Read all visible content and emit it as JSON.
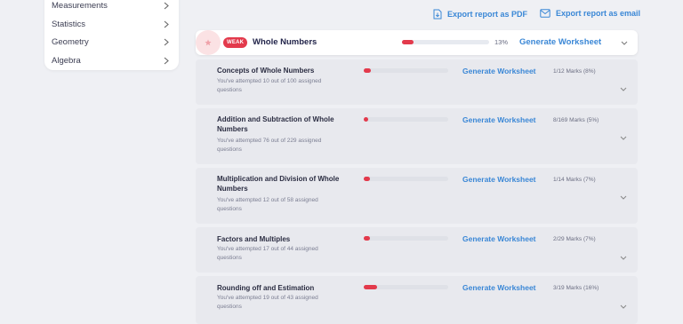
{
  "sidebar": {
    "items": [
      {
        "label": "Measurements"
      },
      {
        "label": "Statistics"
      },
      {
        "label": "Geometry"
      },
      {
        "label": "Algebra"
      }
    ]
  },
  "export": {
    "pdf_label": "Export report as PDF",
    "email_label": "Export report as email"
  },
  "topic": {
    "badge": "WEAK",
    "name": "Whole Numbers",
    "progress_fraction": 0.13,
    "percent_label": "13%",
    "generate_label": "Generate Worksheet"
  },
  "subtopics": [
    {
      "title": "Concepts of Whole Numbers",
      "desc": "You've attempted 10 out of 100 assigned questions",
      "progress_fraction": 0.08,
      "generate_label": "Generate Worksheet",
      "marks": "1/12 Marks (8%)"
    },
    {
      "title": "Addition and Subtraction of Whole Numbers",
      "desc": "You've attempted 76 out of 229 assigned questions",
      "progress_fraction": 0.05,
      "generate_label": "Generate Worksheet",
      "marks": "8/169 Marks (5%)"
    },
    {
      "title": "Multiplication and Division of Whole Numbers",
      "desc": "You've attempted 12 out of 58 assigned questions",
      "progress_fraction": 0.07,
      "generate_label": "Generate Worksheet",
      "marks": "1/14 Marks (7%)"
    },
    {
      "title": "Factors and Multiples",
      "desc": "You've attempted 17 out of 44 assigned questions",
      "progress_fraction": 0.07,
      "generate_label": "Generate Worksheet",
      "marks": "2/29 Marks (7%)"
    },
    {
      "title": "Rounding off and Estimation",
      "desc": "You've attempted 19 out of 43 assigned questions",
      "progress_fraction": 0.16,
      "generate_label": "Generate Worksheet",
      "marks": "3/19 Marks (16%)"
    }
  ],
  "colors": {
    "accent": "#3a87d6",
    "weak": "#e33a4c",
    "background": "#eff0f4"
  }
}
